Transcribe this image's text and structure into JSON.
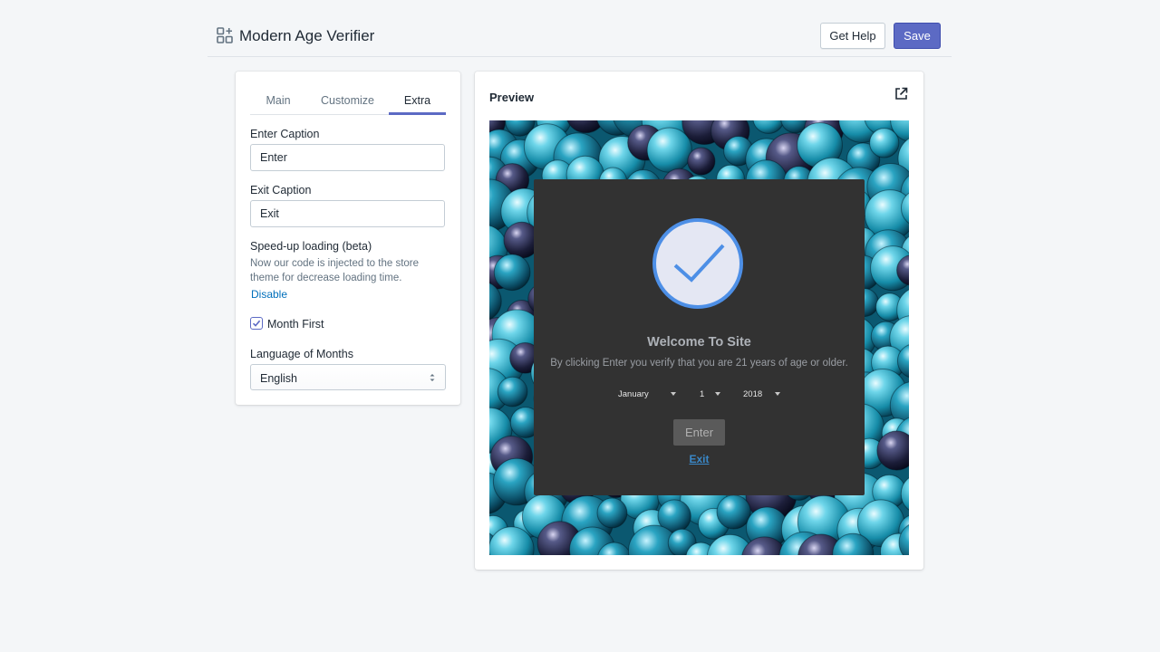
{
  "header": {
    "app_icon": "apps-grid-icon",
    "title": "Modern Age Verifier",
    "help_label": "Get Help",
    "save_label": "Save",
    "accent_color": "#5c6ac4"
  },
  "settings": {
    "tabs": [
      {
        "label": "Main",
        "active": false
      },
      {
        "label": "Customize",
        "active": false
      },
      {
        "label": "Extra",
        "active": true
      }
    ],
    "enter_caption": {
      "label": "Enter Caption",
      "value": "Enter"
    },
    "exit_caption": {
      "label": "Exit Caption",
      "value": "Exit"
    },
    "speedup": {
      "label": "Speed-up loading (beta)",
      "help": "Now our code is injected to the store theme for decrease loading time.",
      "link": "Disable"
    },
    "month_first": {
      "label": "Month First",
      "checked": true
    },
    "language": {
      "label": "Language of Months",
      "value": "English"
    }
  },
  "preview": {
    "title": "Preview",
    "open_icon": "external-link-icon",
    "background": "blue-glass-marbles-image",
    "modal": {
      "icon": "check-circle-icon",
      "heading": "Welcome To Site",
      "text": "By clicking Enter you verify that you are 21 years of age or older.",
      "month": "January",
      "day": "1",
      "year": "2018",
      "enter_label": "Enter",
      "exit_label": "Exit"
    }
  }
}
